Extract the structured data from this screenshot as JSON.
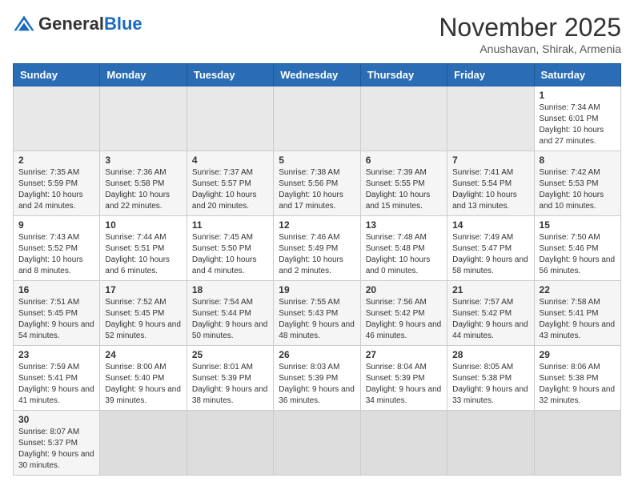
{
  "header": {
    "logo_general": "General",
    "logo_blue": "Blue",
    "title": "November 2025",
    "subtitle": "Anushavan, Shirak, Armenia"
  },
  "days_of_week": [
    "Sunday",
    "Monday",
    "Tuesday",
    "Wednesday",
    "Thursday",
    "Friday",
    "Saturday"
  ],
  "weeks": [
    [
      {
        "day": "",
        "info": ""
      },
      {
        "day": "",
        "info": ""
      },
      {
        "day": "",
        "info": ""
      },
      {
        "day": "",
        "info": ""
      },
      {
        "day": "",
        "info": ""
      },
      {
        "day": "",
        "info": ""
      },
      {
        "day": "1",
        "info": "Sunrise: 7:34 AM\nSunset: 6:01 PM\nDaylight: 10 hours and 27 minutes."
      }
    ],
    [
      {
        "day": "2",
        "info": "Sunrise: 7:35 AM\nSunset: 5:59 PM\nDaylight: 10 hours and 24 minutes."
      },
      {
        "day": "3",
        "info": "Sunrise: 7:36 AM\nSunset: 5:58 PM\nDaylight: 10 hours and 22 minutes."
      },
      {
        "day": "4",
        "info": "Sunrise: 7:37 AM\nSunset: 5:57 PM\nDaylight: 10 hours and 20 minutes."
      },
      {
        "day": "5",
        "info": "Sunrise: 7:38 AM\nSunset: 5:56 PM\nDaylight: 10 hours and 17 minutes."
      },
      {
        "day": "6",
        "info": "Sunrise: 7:39 AM\nSunset: 5:55 PM\nDaylight: 10 hours and 15 minutes."
      },
      {
        "day": "7",
        "info": "Sunrise: 7:41 AM\nSunset: 5:54 PM\nDaylight: 10 hours and 13 minutes."
      },
      {
        "day": "8",
        "info": "Sunrise: 7:42 AM\nSunset: 5:53 PM\nDaylight: 10 hours and 10 minutes."
      }
    ],
    [
      {
        "day": "9",
        "info": "Sunrise: 7:43 AM\nSunset: 5:52 PM\nDaylight: 10 hours and 8 minutes."
      },
      {
        "day": "10",
        "info": "Sunrise: 7:44 AM\nSunset: 5:51 PM\nDaylight: 10 hours and 6 minutes."
      },
      {
        "day": "11",
        "info": "Sunrise: 7:45 AM\nSunset: 5:50 PM\nDaylight: 10 hours and 4 minutes."
      },
      {
        "day": "12",
        "info": "Sunrise: 7:46 AM\nSunset: 5:49 PM\nDaylight: 10 hours and 2 minutes."
      },
      {
        "day": "13",
        "info": "Sunrise: 7:48 AM\nSunset: 5:48 PM\nDaylight: 10 hours and 0 minutes."
      },
      {
        "day": "14",
        "info": "Sunrise: 7:49 AM\nSunset: 5:47 PM\nDaylight: 9 hours and 58 minutes."
      },
      {
        "day": "15",
        "info": "Sunrise: 7:50 AM\nSunset: 5:46 PM\nDaylight: 9 hours and 56 minutes."
      }
    ],
    [
      {
        "day": "16",
        "info": "Sunrise: 7:51 AM\nSunset: 5:45 PM\nDaylight: 9 hours and 54 minutes."
      },
      {
        "day": "17",
        "info": "Sunrise: 7:52 AM\nSunset: 5:45 PM\nDaylight: 9 hours and 52 minutes."
      },
      {
        "day": "18",
        "info": "Sunrise: 7:54 AM\nSunset: 5:44 PM\nDaylight: 9 hours and 50 minutes."
      },
      {
        "day": "19",
        "info": "Sunrise: 7:55 AM\nSunset: 5:43 PM\nDaylight: 9 hours and 48 minutes."
      },
      {
        "day": "20",
        "info": "Sunrise: 7:56 AM\nSunset: 5:42 PM\nDaylight: 9 hours and 46 minutes."
      },
      {
        "day": "21",
        "info": "Sunrise: 7:57 AM\nSunset: 5:42 PM\nDaylight: 9 hours and 44 minutes."
      },
      {
        "day": "22",
        "info": "Sunrise: 7:58 AM\nSunset: 5:41 PM\nDaylight: 9 hours and 43 minutes."
      }
    ],
    [
      {
        "day": "23",
        "info": "Sunrise: 7:59 AM\nSunset: 5:41 PM\nDaylight: 9 hours and 41 minutes."
      },
      {
        "day": "24",
        "info": "Sunrise: 8:00 AM\nSunset: 5:40 PM\nDaylight: 9 hours and 39 minutes."
      },
      {
        "day": "25",
        "info": "Sunrise: 8:01 AM\nSunset: 5:39 PM\nDaylight: 9 hours and 38 minutes."
      },
      {
        "day": "26",
        "info": "Sunrise: 8:03 AM\nSunset: 5:39 PM\nDaylight: 9 hours and 36 minutes."
      },
      {
        "day": "27",
        "info": "Sunrise: 8:04 AM\nSunset: 5:39 PM\nDaylight: 9 hours and 34 minutes."
      },
      {
        "day": "28",
        "info": "Sunrise: 8:05 AM\nSunset: 5:38 PM\nDaylight: 9 hours and 33 minutes."
      },
      {
        "day": "29",
        "info": "Sunrise: 8:06 AM\nSunset: 5:38 PM\nDaylight: 9 hours and 32 minutes."
      }
    ],
    [
      {
        "day": "30",
        "info": "Sunrise: 8:07 AM\nSunset: 5:37 PM\nDaylight: 9 hours and 30 minutes."
      },
      {
        "day": "",
        "info": ""
      },
      {
        "day": "",
        "info": ""
      },
      {
        "day": "",
        "info": ""
      },
      {
        "day": "",
        "info": ""
      },
      {
        "day": "",
        "info": ""
      },
      {
        "day": "",
        "info": ""
      }
    ]
  ]
}
